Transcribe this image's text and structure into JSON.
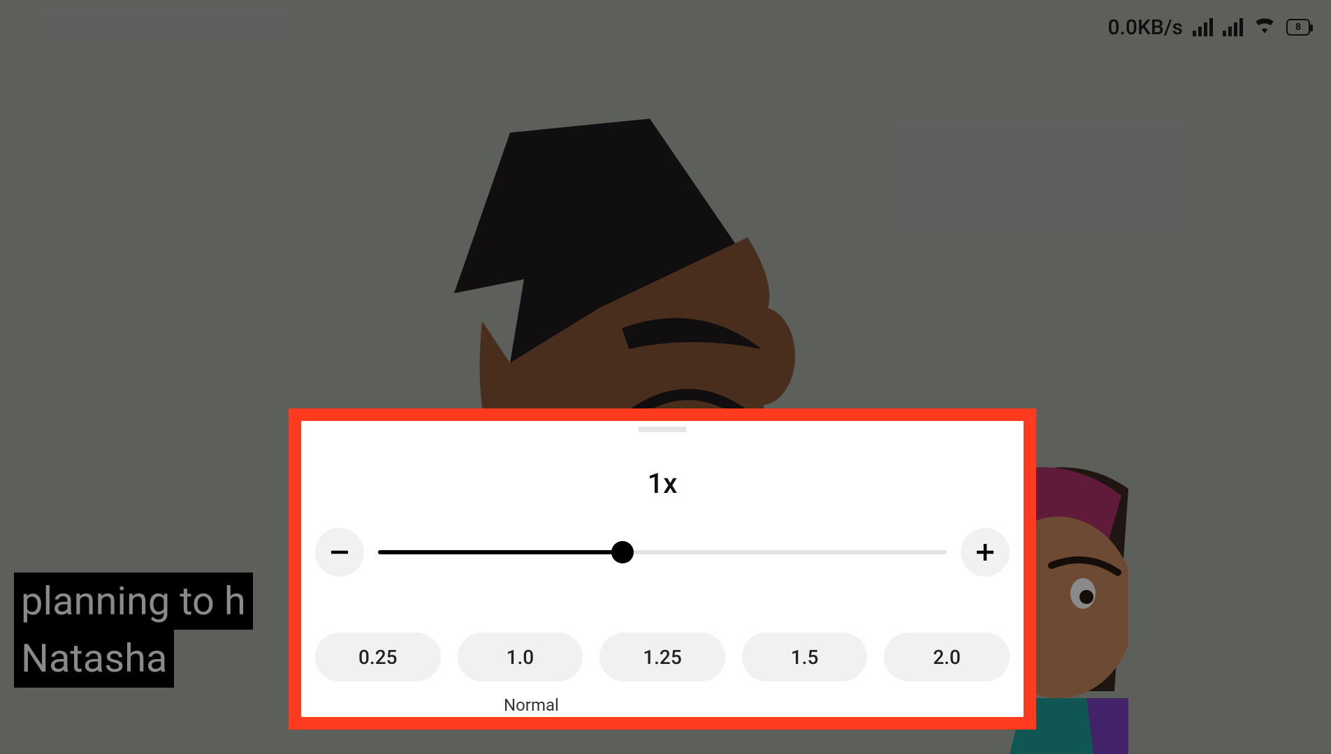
{
  "status": {
    "data_rate": "0.0KB/s",
    "battery_text": "8"
  },
  "caption": {
    "line1": "planning to h",
    "line2": "Natasha"
  },
  "speed_panel": {
    "current_label": "1x",
    "slider_percent": 43,
    "presets": [
      "0.25",
      "1.0",
      "1.25",
      "1.5",
      "2.0"
    ],
    "normal_label": "Normal",
    "highlight_color": "#ff3b1f"
  }
}
